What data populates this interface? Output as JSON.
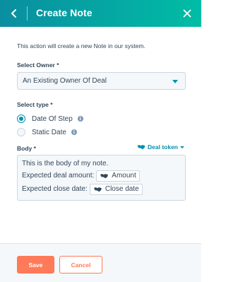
{
  "header": {
    "title": "Create Note",
    "back_icon": "chevron-left-icon",
    "close_icon": "close-icon",
    "gradient_start": "#0a8ea0",
    "gradient_end": "#00bda5"
  },
  "description": "This action will create a new Note in our system.",
  "owner": {
    "label": "Select Owner *",
    "selected": "An Existing Owner Of Deal"
  },
  "type": {
    "label": "Select type *",
    "options": [
      {
        "label": "Date Of Step",
        "checked": true
      },
      {
        "label": "Static Date",
        "checked": false
      }
    ]
  },
  "body": {
    "label": "Body *",
    "token_button": "Deal token",
    "line1": "This is the body of my note.",
    "line2_text": "Expected deal amount:",
    "line2_token": "Amount",
    "line3_text": "Expected close date:",
    "line3_token": "Close date"
  },
  "footer": {
    "save_label": "Save",
    "cancel_label": "Cancel"
  },
  "colors": {
    "accent": "#0091ae",
    "primary_button": "#ff7a59",
    "text": "#33475b"
  }
}
